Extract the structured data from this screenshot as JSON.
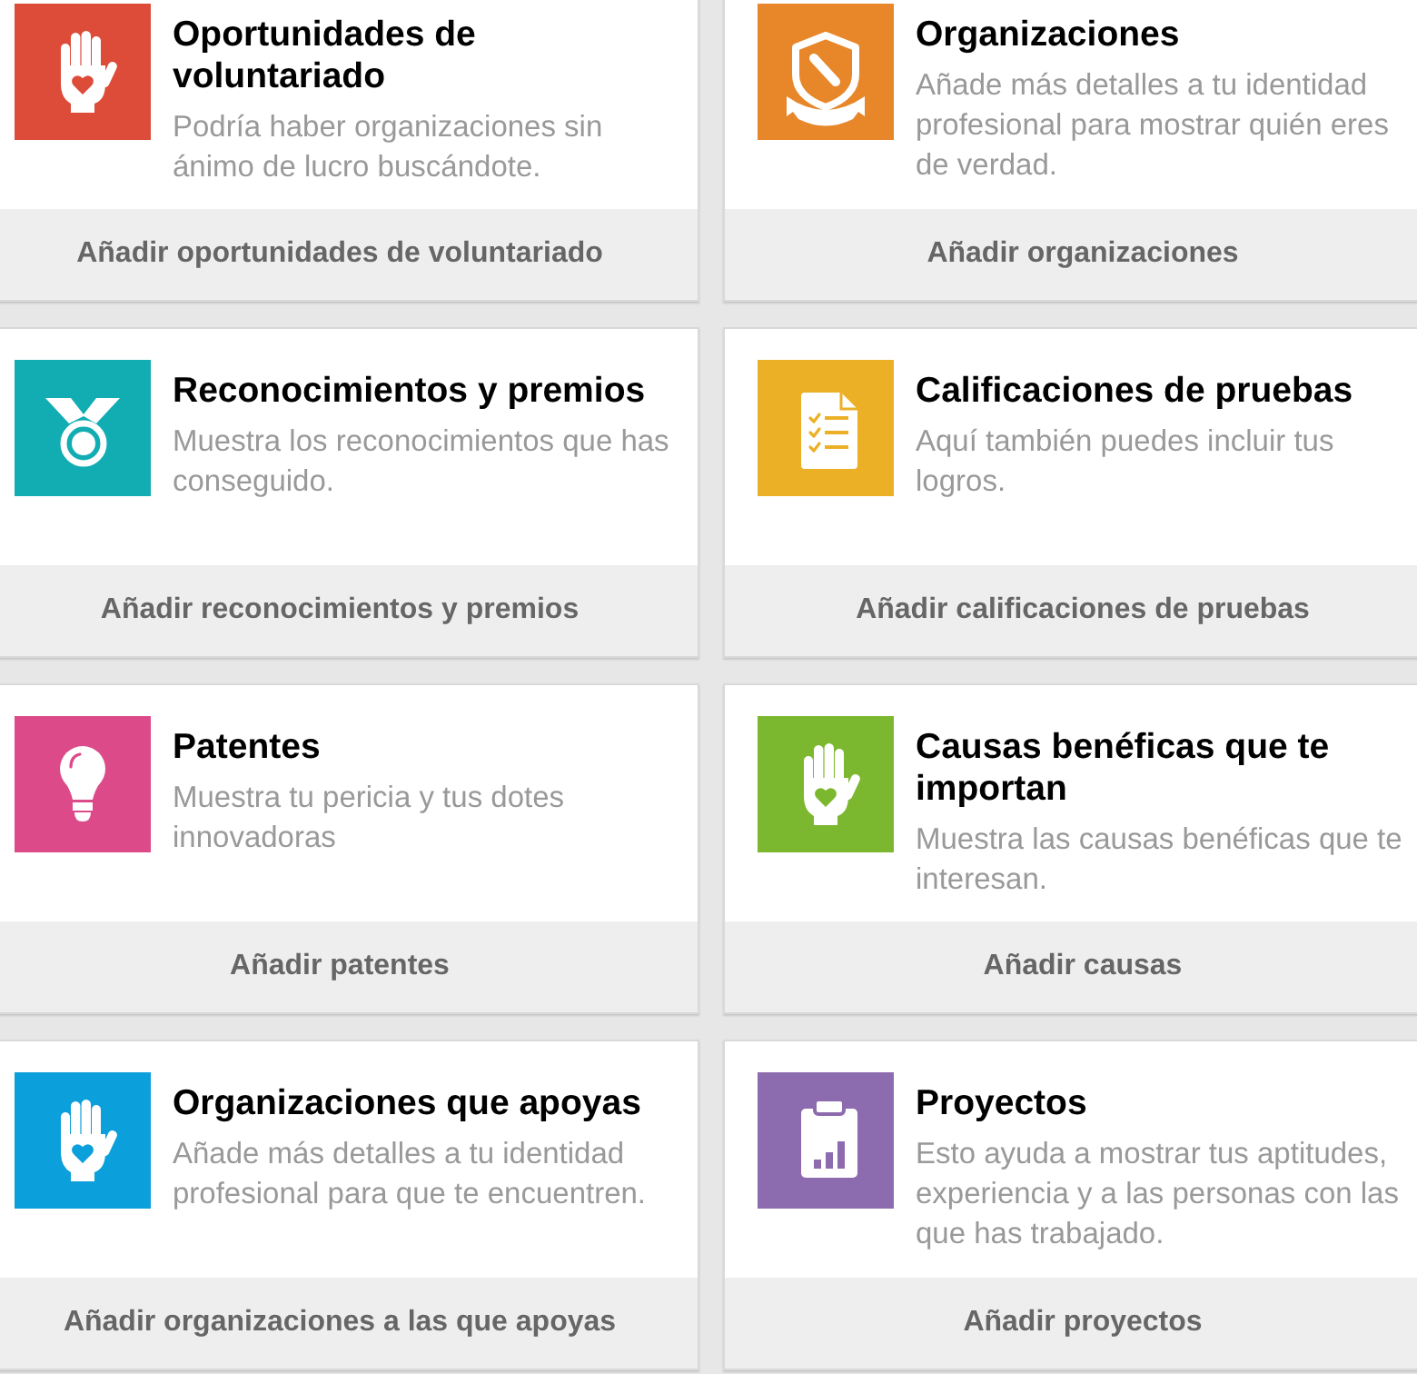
{
  "cards": [
    {
      "kind": "hand",
      "color": "#dd4b39",
      "title": "Oportunidades de voluntariado",
      "description": "Podría haber organizaciones sin ánimo de lucro buscándote.",
      "action": "Añadir oportunidades de voluntariado"
    },
    {
      "kind": "shield",
      "color": "#e8862a",
      "title": "Organizaciones",
      "description": "Añade más detalles a tu identidad profesional para mostrar quién eres de verdad.",
      "action": "Añadir organizaciones"
    },
    {
      "kind": "medal",
      "color": "#12adb3",
      "title": "Reconocimientos y premios",
      "description": "Muestra los reconocimientos que has conseguido.",
      "action": "Añadir reconocimientos y premios"
    },
    {
      "kind": "checklist",
      "color": "#ecb026",
      "title": "Calificaciones de pruebas",
      "description": "Aquí también puedes incluir tus logros.",
      "action": "Añadir calificaciones de pruebas"
    },
    {
      "kind": "bulb",
      "color": "#dc4a8a",
      "title": "Patentes",
      "description": "Muestra tu pericia y tus dotes innovadoras",
      "action": "Añadir patentes"
    },
    {
      "kind": "hand",
      "color": "#7cb82f",
      "title": "Causas benéficas que te importan",
      "description": "Muestra las causas benéficas que te interesan.",
      "action": "Añadir causas"
    },
    {
      "kind": "hand",
      "color": "#0b9fdb",
      "title": "Organizaciones que apoyas",
      "description": "Añade más detalles a tu identidad profesional para que te encuentren.",
      "action": "Añadir organizaciones a las que apoyas"
    },
    {
      "kind": "clipboard",
      "color": "#8c6bae",
      "title": "Proyectos",
      "description": "Esto ayuda a mostrar tus aptitudes, experiencia y a las personas con las que has trabajado.",
      "action": "Añadir proyectos"
    }
  ]
}
